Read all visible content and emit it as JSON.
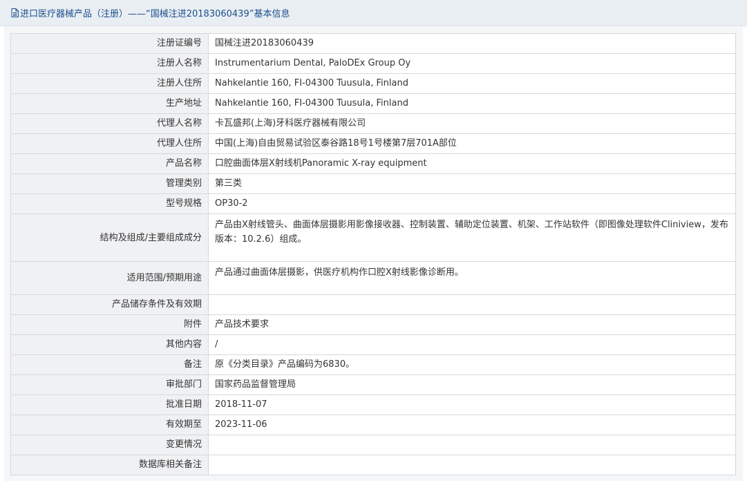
{
  "header": {
    "icon": "document-icon",
    "title": "进口医疗器械产品（注册）——“国械注进20183060439”基本信息"
  },
  "rows": [
    {
      "label": "注册证编号",
      "value": "国械注进20183060439"
    },
    {
      "label": "注册人名称",
      "value": "Instrumentarium Dental, PaloDEx Group Oy"
    },
    {
      "label": "注册人住所",
      "value": "Nahkelantie 160, FI-04300 Tuusula, Finland"
    },
    {
      "label": "生产地址",
      "value": "Nahkelantie 160, FI-04300 Tuusula, Finland"
    },
    {
      "label": "代理人名称",
      "value": "卡瓦盛邦(上海)牙科医疗器械有限公司"
    },
    {
      "label": "代理人住所",
      "value": "中国(上海)自由贸易试验区泰谷路18号1号楼第7层701A部位"
    },
    {
      "label": "产品名称",
      "value": "口腔曲面体层X射线机Panoramic X-ray equipment"
    },
    {
      "label": "管理类别",
      "value": "第三类"
    },
    {
      "label": "型号规格",
      "value": "OP30-2"
    },
    {
      "label": "结构及组成/主要组成成分",
      "value": "产品由X射线管头、曲面体层摄影用影像接收器、控制装置、辅助定位装置、机架、工作站软件（即图像处理软件Cliniview，发布版本：10.2.6）组成。"
    },
    {
      "label": "适用范围/预期用途",
      "value": "产品通过曲面体层摄影，供医疗机构作口腔X射线影像诊断用。"
    },
    {
      "label": "产品储存条件及有效期",
      "value": ""
    },
    {
      "label": "附件",
      "value": "产品技术要求"
    },
    {
      "label": "其他内容",
      "value": "/"
    },
    {
      "label": "备注",
      "value": "原《分类目录》产品编码为6830。"
    },
    {
      "label": "审批部门",
      "value": "国家药品监督管理局"
    },
    {
      "label": "批准日期",
      "value": "2018-11-07"
    },
    {
      "label": "有效期至",
      "value": "2023-11-06"
    },
    {
      "label": "变更情况",
      "value": ""
    },
    {
      "label": "数据库相关备注",
      "value": ""
    }
  ],
  "colors": {
    "header_bg": "#e9eef3",
    "header_text": "#1a4f8c",
    "label_bg": "#f0f1f3",
    "border": "#d5d8dc"
  }
}
